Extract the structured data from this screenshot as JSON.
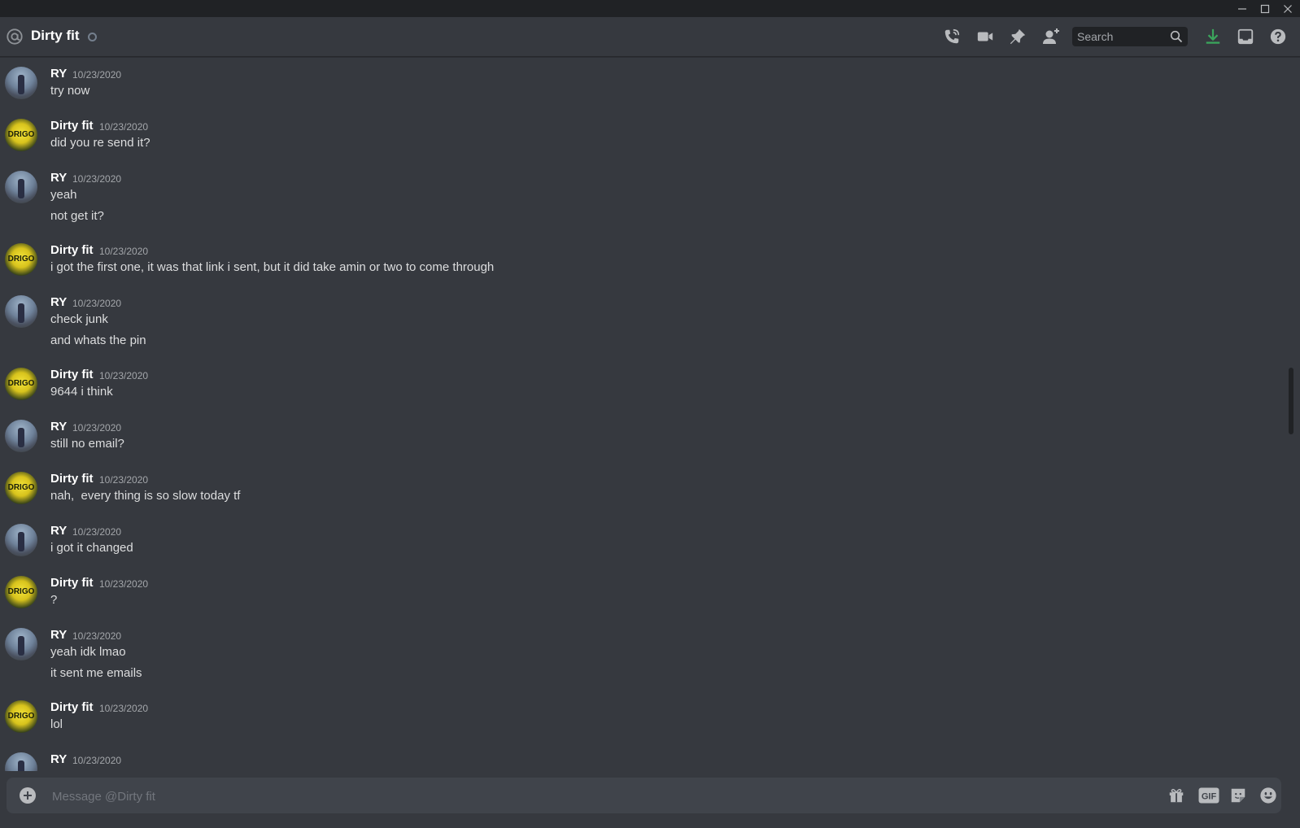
{
  "window": {
    "controls": [
      "minimize-icon",
      "maximize-icon",
      "close-icon"
    ]
  },
  "header": {
    "title": "Dirty fit",
    "search_placeholder": "Search",
    "icons": [
      "call-icon",
      "video-icon",
      "pin-icon",
      "add-friend-icon",
      "search-icon",
      "download-icon",
      "inbox-icon",
      "help-icon"
    ],
    "colors": {
      "download": "#3ba55c",
      "background": "#36393f",
      "titlebar": "#202225"
    }
  },
  "messages": [
    {
      "author": "RY",
      "avatar": "ry",
      "timestamp": "10/23/2020",
      "lines": [
        "try now"
      ]
    },
    {
      "author": "Dirty fit",
      "avatar": "df",
      "timestamp": "10/23/2020",
      "lines": [
        "did you re send it?"
      ]
    },
    {
      "author": "RY",
      "avatar": "ry",
      "timestamp": "10/23/2020",
      "lines": [
        "yeah",
        "not get it?"
      ]
    },
    {
      "author": "Dirty fit",
      "avatar": "df",
      "timestamp": "10/23/2020",
      "lines": [
        "i got the first one, it was that link i sent, but it did take amin or two to come through"
      ]
    },
    {
      "author": "RY",
      "avatar": "ry",
      "timestamp": "10/23/2020",
      "lines": [
        "check junk",
        "and whats the pin"
      ]
    },
    {
      "author": "Dirty fit",
      "avatar": "df",
      "timestamp": "10/23/2020",
      "lines": [
        "9644 i think"
      ]
    },
    {
      "author": "RY",
      "avatar": "ry",
      "timestamp": "10/23/2020",
      "lines": [
        "still no email?"
      ]
    },
    {
      "author": "Dirty fit",
      "avatar": "df",
      "timestamp": "10/23/2020",
      "lines": [
        "nah,  every thing is so slow today tf"
      ]
    },
    {
      "author": "RY",
      "avatar": "ry",
      "timestamp": "10/23/2020",
      "lines": [
        "i got it changed"
      ]
    },
    {
      "author": "Dirty fit",
      "avatar": "df",
      "timestamp": "10/23/2020",
      "lines": [
        "?"
      ]
    },
    {
      "author": "RY",
      "avatar": "ry",
      "timestamp": "10/23/2020",
      "lines": [
        "yeah idk lmao",
        "it sent me emails"
      ]
    },
    {
      "author": "Dirty fit",
      "avatar": "df",
      "timestamp": "10/23/2020",
      "lines": [
        "lol"
      ]
    },
    {
      "author": "RY",
      "avatar": "ry",
      "timestamp": "10/23/2020",
      "lines": []
    }
  ],
  "composer": {
    "placeholder": "Message @Dirty fit",
    "icons": [
      "add-attachment-icon",
      "gift-icon",
      "gif-icon",
      "sticker-icon",
      "emoji-icon"
    ],
    "gif_label": "GIF"
  },
  "avatar_text": {
    "df": "DRIGO"
  }
}
